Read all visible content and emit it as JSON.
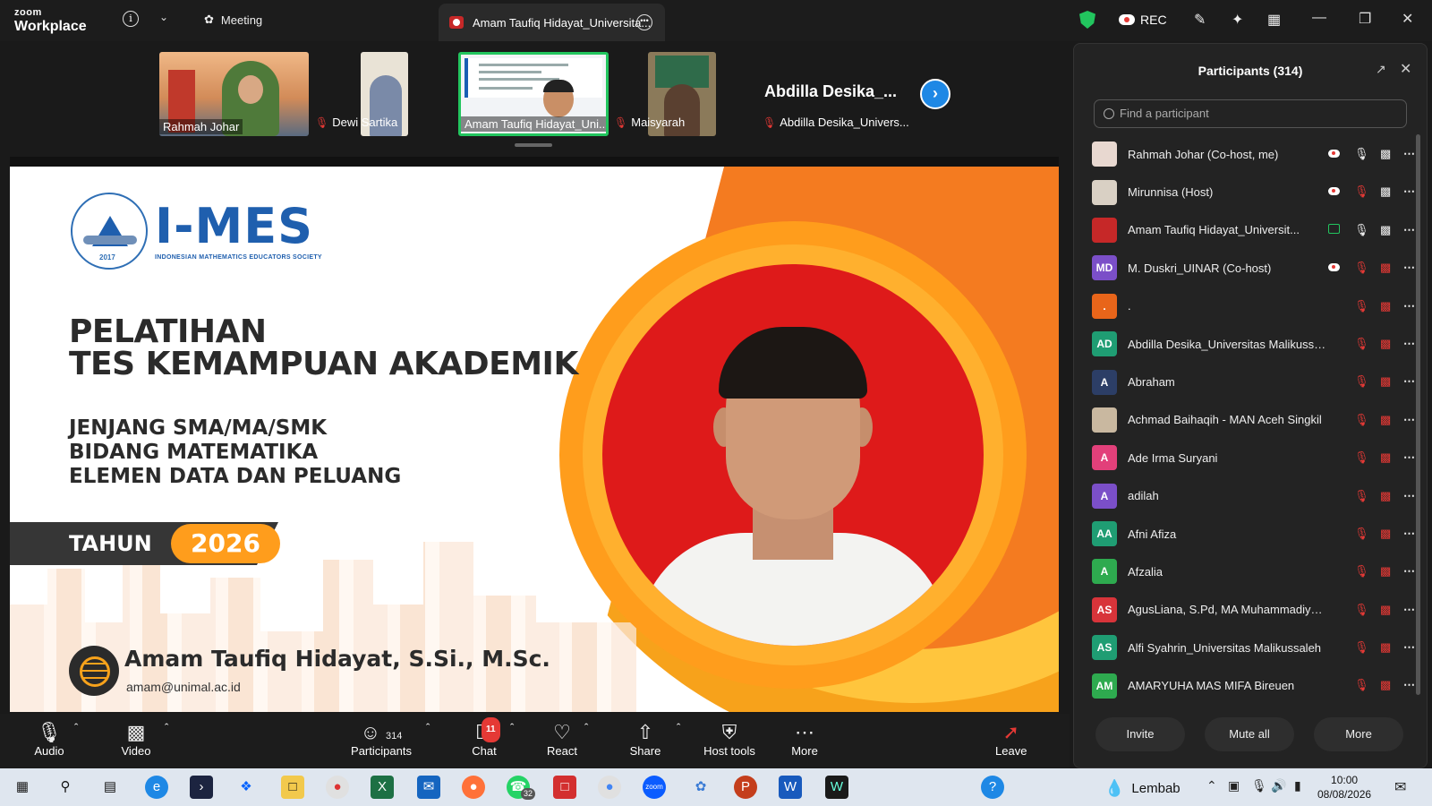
{
  "app": {
    "brand_top": "zoom",
    "brand_bottom": "Workplace",
    "meeting_label": "Meeting",
    "active_tab": "Amam Taufiq Hidayat_Universita...",
    "rec_label": "REC"
  },
  "strip": {
    "thumbs": [
      {
        "label": "Rahmah Johar",
        "muted": false
      },
      {
        "label": "Dewi Sartika",
        "muted": true
      },
      {
        "label": "Amam Taufiq Hidayat_Uni...",
        "muted": false
      },
      {
        "label": "Maisyarah",
        "muted": true
      }
    ],
    "name_tile": "Abdilla  Desika_...",
    "name_tile_label": "Abdilla Desika_Univers..."
  },
  "slide": {
    "org_title": "I-MES",
    "org_subtitle": "INDONESIAN MATHEMATICS EDUCATORS SOCIETY",
    "seal_year": "2017",
    "heading_line1": "PELATIHAN",
    "heading_line2": "TES KEMAMPUAN AKADEMIK",
    "sub_line1": "JENJANG SMA/MA/SMK",
    "sub_line2": "BIDANG MATEMATIKA",
    "sub_line3": "ELEMEN DATA DAN PELUANG",
    "year_label": "TAHUN",
    "year_value": "2026",
    "speaker_name": "Amam Taufiq Hidayat, S.Si., M.Sc.",
    "speaker_email": "amam@unimal.ac.id"
  },
  "toolbar": {
    "audio": "Audio",
    "video": "Video",
    "participants": "Participants",
    "participants_count": "314",
    "chat": "Chat",
    "chat_badge": "11",
    "react": "React",
    "share": "Share",
    "host_tools": "Host tools",
    "more": "More",
    "leave": "Leave"
  },
  "panel": {
    "title": "Participants (314)",
    "search_placeholder": "Find a participant",
    "invite": "Invite",
    "mute_all": "Mute all",
    "more": "More",
    "participants": [
      {
        "name": "Rahmah Johar (Co-host, me)",
        "initials": "",
        "color": "#e8d8d0",
        "rec": true,
        "mic": "on",
        "video": "on"
      },
      {
        "name": "Mirunnisa (Host)",
        "initials": "",
        "color": "#d9d0c4",
        "rec": true,
        "mic": "off",
        "video": "on"
      },
      {
        "name": "Amam Taufiq Hidayat_Universit...",
        "initials": "",
        "color": "#c62828",
        "share": true,
        "mic": "on",
        "video": "on"
      },
      {
        "name": "M. Duskri_UINAR (Co-host)",
        "initials": "MD",
        "color": "#7b4fc8",
        "rec": true,
        "mic": "off",
        "video": "off"
      },
      {
        "name": ".",
        "initials": ".",
        "color": "#e8651a",
        "mic": "off",
        "video": "off"
      },
      {
        "name": "Abdilla Desika_Universitas Malikussal...",
        "initials": "AD",
        "color": "#1f9d73",
        "mic": "off",
        "video": "off"
      },
      {
        "name": "Abraham",
        "initials": "A",
        "color": "#2c3e66",
        "mic": "off",
        "video": "off"
      },
      {
        "name": "Achmad Baihaqih - MAN Aceh Singkil",
        "initials": "",
        "color": "#c9b8a0",
        "mic": "off",
        "video": "off"
      },
      {
        "name": "Ade Irma Suryani",
        "initials": "A",
        "color": "#e2407a",
        "mic": "off",
        "video": "off"
      },
      {
        "name": "adilah",
        "initials": "A",
        "color": "#7b4fc8",
        "mic": "off",
        "video": "off"
      },
      {
        "name": "Afni Afiza",
        "initials": "AA",
        "color": "#1f9d73",
        "mic": "off",
        "video": "off"
      },
      {
        "name": "Afzalia",
        "initials": "A",
        "color": "#2eaa4f",
        "mic": "off",
        "video": "off"
      },
      {
        "name": "AgusLiana, S.Pd, MA Muhammadiyah...",
        "initials": "AS",
        "color": "#d8343a",
        "mic": "off",
        "video": "off"
      },
      {
        "name": "Alfi Syahrin_Universitas Malikussaleh",
        "initials": "AS",
        "color": "#1f9d73",
        "mic": "off",
        "video": "off"
      },
      {
        "name": "AMARYUHA MAS MIFA Bireuen",
        "initials": "AM",
        "color": "#2eaa4f",
        "mic": "off",
        "video": "off"
      }
    ]
  },
  "taskbar": {
    "weather": "Lembab",
    "time": "10:00",
    "date": "08/08/2026",
    "whatsapp_badge": "32"
  }
}
